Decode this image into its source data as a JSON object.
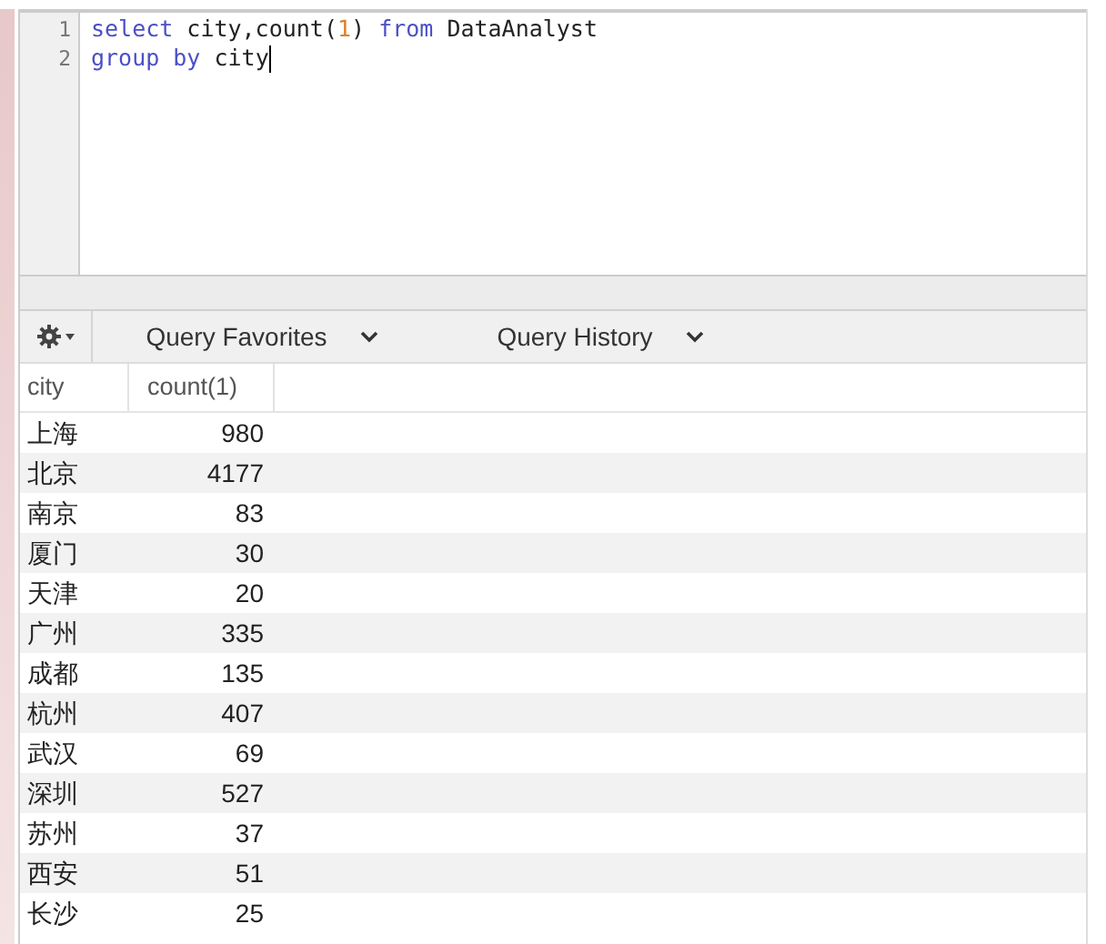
{
  "editor": {
    "lines": [
      {
        "number": "1",
        "cursor": false,
        "tokens": [
          {
            "kind": "keyword",
            "text": "select"
          },
          {
            "kind": "plain",
            "text": " city,count("
          },
          {
            "kind": "number",
            "text": "1"
          },
          {
            "kind": "plain",
            "text": ") "
          },
          {
            "kind": "keyword",
            "text": "from"
          },
          {
            "kind": "plain",
            "text": " DataAnalyst"
          }
        ]
      },
      {
        "number": "2",
        "cursor": true,
        "tokens": [
          {
            "kind": "keyword",
            "text": "group by"
          },
          {
            "kind": "plain",
            "text": " city"
          }
        ]
      }
    ]
  },
  "toolbar": {
    "tabs": [
      {
        "label": "Query Favorites"
      },
      {
        "label": "Query History"
      }
    ]
  },
  "table": {
    "columns": [
      "city",
      "count(1)"
    ],
    "rows": [
      [
        "上海",
        "980"
      ],
      [
        "北京",
        "4177"
      ],
      [
        "南京",
        "83"
      ],
      [
        "厦门",
        "30"
      ],
      [
        "天津",
        "20"
      ],
      [
        "广州",
        "335"
      ],
      [
        "成都",
        "135"
      ],
      [
        "杭州",
        "407"
      ],
      [
        "武汉",
        "69"
      ],
      [
        "深圳",
        "527"
      ],
      [
        "苏州",
        "37"
      ],
      [
        "西安",
        "51"
      ],
      [
        "长沙",
        "25"
      ]
    ]
  }
}
